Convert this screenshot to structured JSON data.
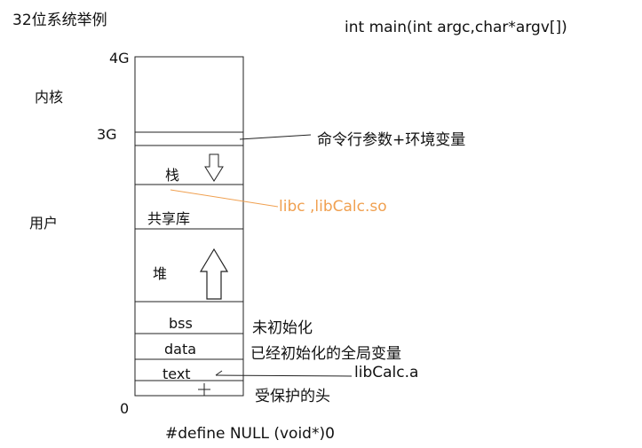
{
  "title": "32位系统举例",
  "code_signature": "int main(int argc,char*argv[])",
  "addresses": {
    "top": "4G",
    "kernel_boundary": "3G",
    "bottom": "0"
  },
  "regions": {
    "kernel": "内核",
    "user": "用户"
  },
  "segments": {
    "stack": "栈",
    "shared_lib": "共享库",
    "heap": "堆",
    "bss": "bss",
    "data": "data",
    "text": "text"
  },
  "annotations": {
    "args_env": "命令行参数+环境变量",
    "shared_lib_files": "libc ,libCalc.so",
    "bss_desc": "未初始化",
    "data_desc": "已经初始化的全局变量",
    "static_lib": "libCalc.a",
    "protected_head": "受保护的头"
  },
  "footer_code": "#define NULL (void*)0",
  "colors": {
    "line": "#222222",
    "text": "#111111",
    "shared_lib_annotation": "#f0a050"
  }
}
